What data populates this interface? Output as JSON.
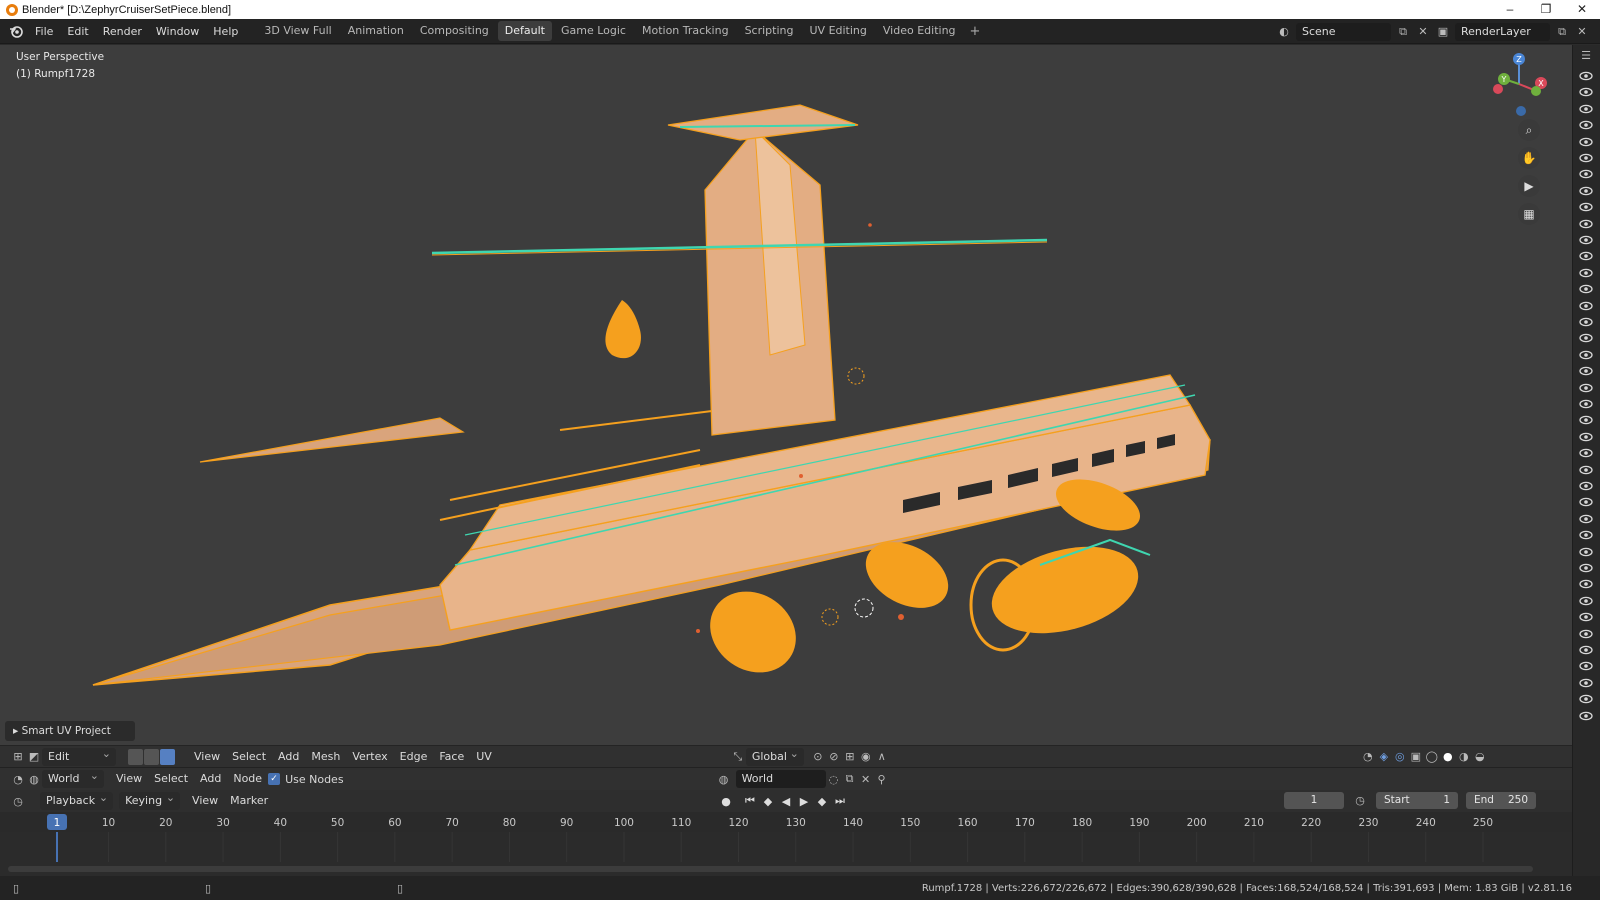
{
  "window": {
    "title": "Blender* [D:\\ZephyrCruiserSetPiece.blend]",
    "controls": [
      "–",
      "❐",
      "✕"
    ]
  },
  "menubar": {
    "items": [
      "File",
      "Edit",
      "Render",
      "Window",
      "Help"
    ]
  },
  "workspaces": {
    "tabs": [
      "3D View Full",
      "Animation",
      "Compositing",
      "Default",
      "Game Logic",
      "Motion Tracking",
      "Scripting",
      "UV Editing",
      "Video Editing"
    ],
    "active": "Default",
    "add": "+"
  },
  "scene": {
    "name": "Scene",
    "render_layer": "RenderLayer"
  },
  "viewport": {
    "perspective_label": "User Perspective",
    "object_label": "(1) Rumpf1728",
    "gizmo_axes": [
      "X",
      "Y",
      "Z"
    ],
    "operator_panel": "Smart UV Project"
  },
  "viewport_header": {
    "mode": "Edit Mode",
    "menus": [
      "View",
      "Select",
      "Add",
      "Mesh",
      "Vertex",
      "Edge",
      "Face",
      "UV"
    ],
    "orientation": "Global"
  },
  "node_header": {
    "type": "World",
    "menus": [
      "View",
      "Select",
      "Add",
      "Node"
    ],
    "use_nodes_label": "Use Nodes",
    "use_nodes_checked": true,
    "world_field": "World"
  },
  "timeline": {
    "menus": [
      "Playback",
      "Keying",
      "View",
      "Marker"
    ],
    "current_frame": "1",
    "start_label": "Start",
    "start_value": "1",
    "end_label": "End",
    "end_value": "250",
    "ruler_labels": [
      "1",
      "10",
      "20",
      "30",
      "40",
      "50",
      "60",
      "70",
      "80",
      "90",
      "100",
      "110",
      "120",
      "130",
      "140",
      "150",
      "160",
      "170",
      "180",
      "190",
      "200",
      "210",
      "220",
      "230",
      "240",
      "250"
    ]
  },
  "statusbar": {
    "text": "Rumpf.1728 | Verts:226,672/226,672 | Edges:390,628/390,628 | Faces:168,524/168,524 | Tris:391,693 | Mem: 1.83 GiB | v2.81.16"
  },
  "colors": {
    "accent_blue": "#4772b3",
    "selection_orange": "#f5a01e",
    "active_edge_teal": "#3fd6b0",
    "mesh_face": "#e8b48a"
  }
}
